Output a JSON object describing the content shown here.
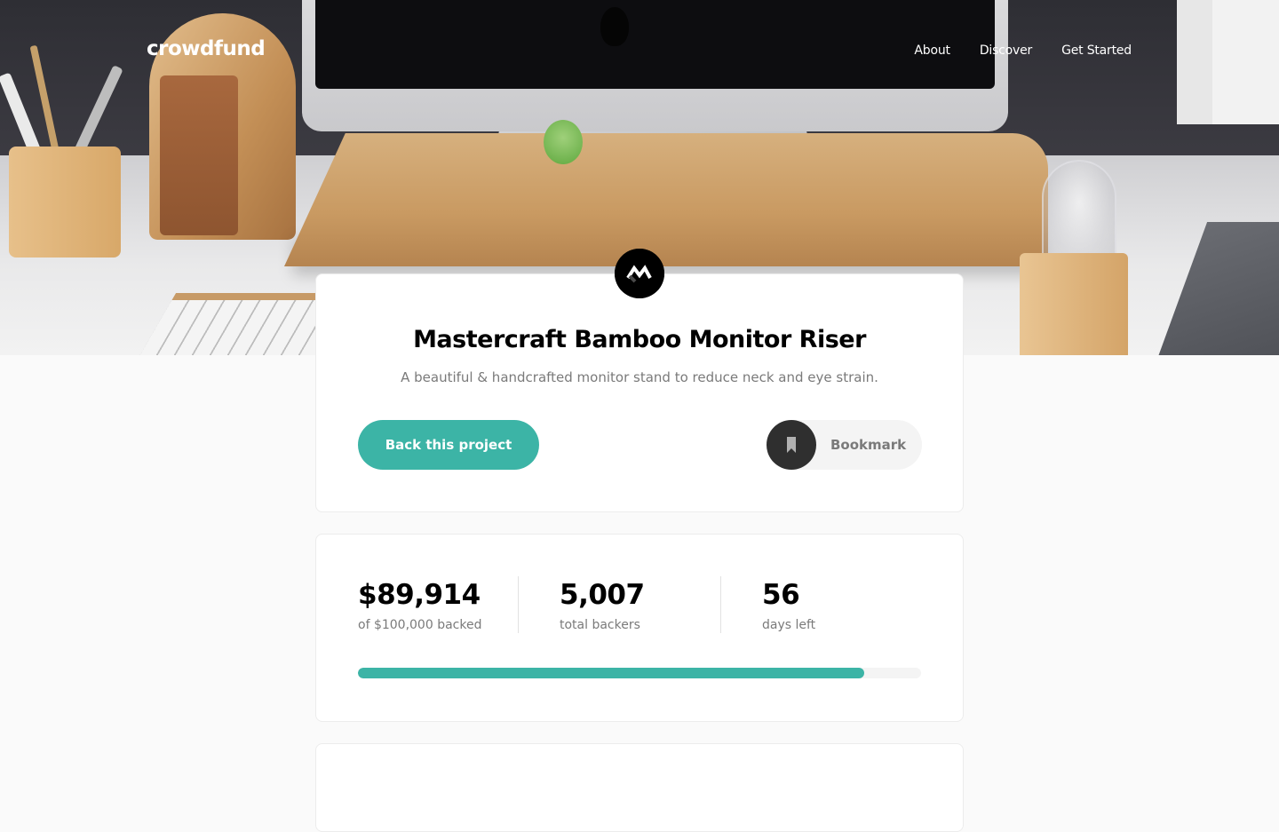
{
  "brand": "crowdfund",
  "nav": {
    "items": [
      "About",
      "Discover",
      "Get Started"
    ]
  },
  "project": {
    "logo_icon": "mastercraft-logo-icon",
    "title": "Mastercraft Bamboo Monitor Riser",
    "subtitle": "A beautiful & handcrafted monitor stand to reduce neck and eye strain.",
    "back_label": "Back this project",
    "bookmark_label": "Bookmark",
    "bookmark_icon": "bookmark-icon"
  },
  "stats": {
    "backed": {
      "value": "$89,914",
      "label": "of $100,000 backed"
    },
    "backers": {
      "value": "5,007",
      "label": "total backers"
    },
    "days": {
      "value": "56",
      "label": "days left"
    },
    "progress_fraction": 0.89914
  },
  "colors": {
    "accent": "#3cb4a6",
    "dark": "#2f2f2f",
    "muted_text": "#7a7a7a",
    "page_bg": "#fafafa"
  }
}
